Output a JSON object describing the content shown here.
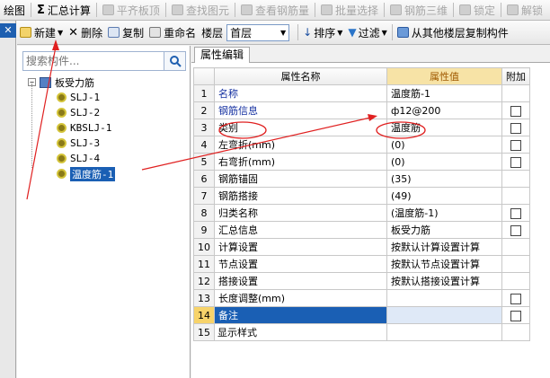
{
  "toolbar1": {
    "items": [
      {
        "label": "绘图",
        "icon": "draw-icon",
        "disabled": false
      },
      {
        "label": "汇总计算",
        "icon": "sigma-icon",
        "disabled": false
      },
      {
        "label": "平齐板顶",
        "icon": "align-slab-icon",
        "disabled": true
      },
      {
        "label": "查找图元",
        "icon": "find-element-icon",
        "disabled": true
      },
      {
        "label": "查看钢筋量",
        "icon": "view-rebar-icon",
        "disabled": true
      },
      {
        "label": "批量选择",
        "icon": "batch-select-icon",
        "disabled": true
      },
      {
        "label": "钢筋三维",
        "icon": "rebar-3d-icon",
        "disabled": true
      },
      {
        "label": "锁定",
        "icon": "lock-icon",
        "disabled": true
      },
      {
        "label": "解锁",
        "icon": "unlock-icon",
        "disabled": true
      }
    ]
  },
  "toolbar2": {
    "new": "新建",
    "delete": "删除",
    "copy": "复制",
    "rename": "重命名",
    "floor_label": "楼层",
    "floor_value": "首层",
    "sort": "排序",
    "filter": "过滤",
    "copy_from_floor": "从其他楼层复制构件"
  },
  "left_panel": {
    "search_placeholder": "搜索构件...",
    "tree": {
      "root": "板受力筋",
      "children": [
        "SLJ-1",
        "SLJ-2",
        "KBSLJ-1",
        "SLJ-3",
        "SLJ-4",
        "温度筋-1"
      ],
      "selected_index": 5
    }
  },
  "property_panel": {
    "tab": "属性编辑",
    "columns": {
      "name": "属性名称",
      "value": "属性值",
      "extra": "附加"
    },
    "rows": [
      {
        "n": "1",
        "name": "名称",
        "value": "温度筋-1",
        "checkbox": false,
        "blue": true
      },
      {
        "n": "2",
        "name": "钢筋信息",
        "value": "ф12@200",
        "checkbox": true,
        "blue": true
      },
      {
        "n": "3",
        "name": "类别",
        "value": "温度筋",
        "checkbox": true,
        "blue": false
      },
      {
        "n": "4",
        "name": "左弯折(mm)",
        "value": "(0)",
        "checkbox": true,
        "blue": false
      },
      {
        "n": "5",
        "name": "右弯折(mm)",
        "value": "(0)",
        "checkbox": true,
        "blue": false
      },
      {
        "n": "6",
        "name": "钢筋锚固",
        "value": "(35)",
        "checkbox": false,
        "blue": false
      },
      {
        "n": "7",
        "name": "钢筋搭接",
        "value": "(49)",
        "checkbox": false,
        "blue": false
      },
      {
        "n": "8",
        "name": "归类名称",
        "value": "(温度筋-1)",
        "checkbox": true,
        "blue": false
      },
      {
        "n": "9",
        "name": "汇总信息",
        "value": "板受力筋",
        "checkbox": true,
        "blue": false
      },
      {
        "n": "10",
        "name": "计算设置",
        "value": "按默认计算设置计算",
        "checkbox": false,
        "blue": false
      },
      {
        "n": "11",
        "name": "节点设置",
        "value": "按默认节点设置计算",
        "checkbox": false,
        "blue": false
      },
      {
        "n": "12",
        "name": "搭接设置",
        "value": "按默认搭接设置计算",
        "checkbox": false,
        "blue": false
      },
      {
        "n": "13",
        "name": "长度调整(mm)",
        "value": "",
        "checkbox": true,
        "blue": false
      },
      {
        "n": "14",
        "name": "备注",
        "value": "",
        "checkbox": true,
        "blue": false,
        "highlight": true
      },
      {
        "n": "15",
        "name": "显示样式",
        "value": "",
        "checkbox": false,
        "blue": false,
        "expandable": true
      }
    ]
  },
  "colors": {
    "accent": "#1a5fb4",
    "annotation": "#e02020",
    "header_value_bg": "#f7e3a6"
  }
}
